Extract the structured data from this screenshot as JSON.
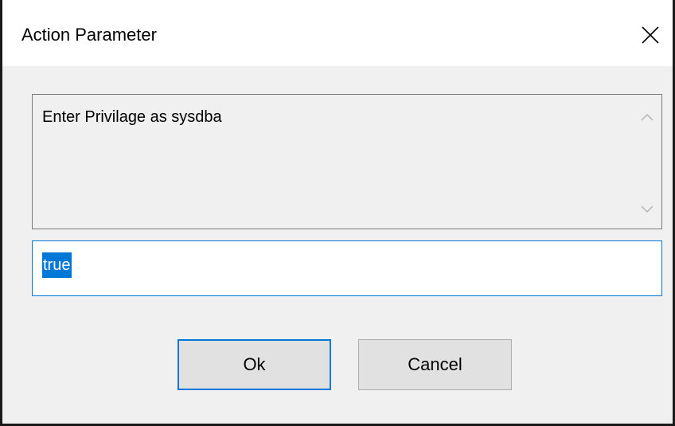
{
  "window": {
    "title": "Action Parameter",
    "close_icon": "close-icon"
  },
  "prompt": {
    "text": "Enter Privilage as sysdba",
    "scroll_up_icon": "chevron-up-icon",
    "scroll_down_icon": "chevron-down-icon"
  },
  "input": {
    "value": "true",
    "selected": true
  },
  "buttons": {
    "ok_label": "Ok",
    "cancel_label": "Cancel"
  },
  "colors": {
    "accent": "#0078d7",
    "dialog_bg": "#f0f0f0",
    "button_bg": "#e1e1e1"
  }
}
